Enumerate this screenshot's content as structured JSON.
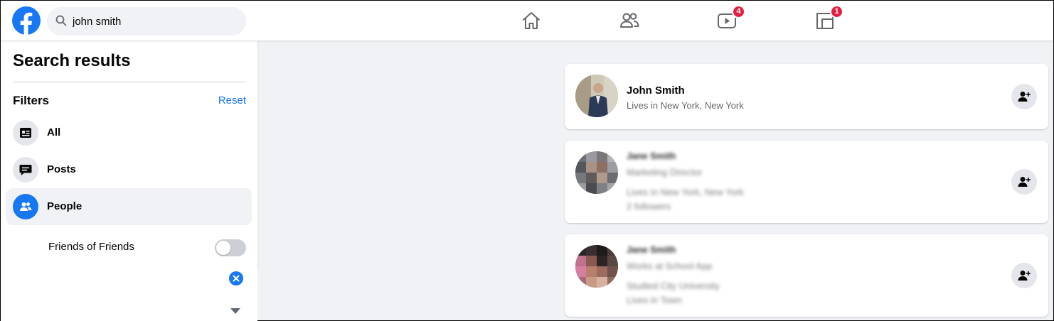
{
  "search": {
    "query": "john smith"
  },
  "nav": {
    "watch_badge": "4",
    "gaming_badge": "1"
  },
  "sidebar": {
    "title": "Search results",
    "filters_label": "Filters",
    "reset_label": "Reset",
    "items": [
      {
        "label": "All",
        "icon": "all-results-icon",
        "active": false
      },
      {
        "label": "Posts",
        "icon": "posts-icon",
        "active": false
      },
      {
        "label": "People",
        "icon": "people-icon",
        "active": true
      }
    ],
    "sub_filter": {
      "label": "Friends of Friends",
      "enabled": false
    }
  },
  "results": [
    {
      "name": "John Smith",
      "lines": [
        "Lives in New York, New York"
      ]
    },
    {
      "name": "Jane Smith",
      "lines": [
        "Marketing Director",
        "Lives in New York, New York",
        "2 followers"
      ]
    },
    {
      "name": "Jane Smith",
      "lines": [
        "Works at School App",
        "Studied City University",
        "Lives in Town"
      ]
    }
  ],
  "colors": {
    "brand": "#1877f2",
    "badge": "#e41e3f",
    "background": "#f0f2f5"
  }
}
